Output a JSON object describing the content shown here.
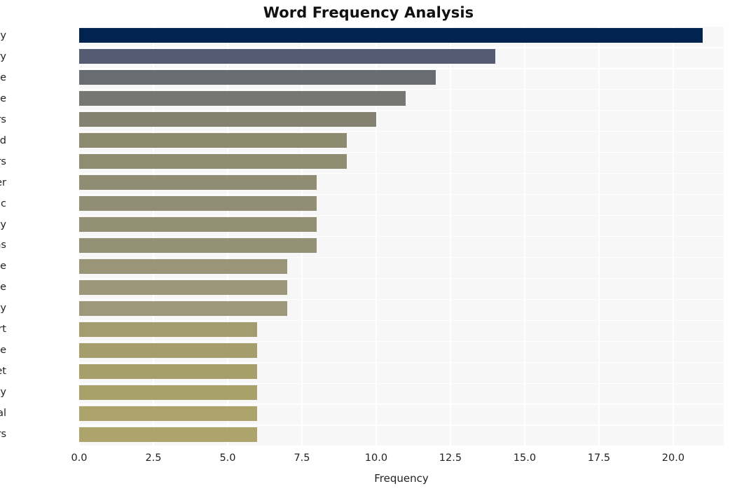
{
  "chart_data": {
    "type": "bar",
    "orientation": "horizontal",
    "title": "Word Frequency Analysis",
    "xlabel": "Frequency",
    "ylabel": "",
    "categories": [
      "cybersecurity",
      "industry",
      "active",
      "time",
      "buyers",
      "trend",
      "investors",
      "cyber",
      "strategic",
      "activity",
      "acquisitions",
      "change",
      "private",
      "equity",
      "report",
      "altitude",
      "let",
      "pretty",
      "deal",
      "years"
    ],
    "values": [
      21,
      14,
      12,
      11,
      10,
      9,
      9,
      8,
      8,
      8,
      8,
      7,
      7,
      7,
      6,
      6,
      6,
      6,
      6,
      6
    ],
    "bar_colors": [
      "#002350",
      "#565b74",
      "#6a6c74",
      "#767672",
      "#83816f",
      "#8d8a70",
      "#908c72",
      "#918d74",
      "#928e75",
      "#939076",
      "#959177",
      "#9a9479",
      "#9c967a",
      "#9e987b",
      "#a39c6e",
      "#a59e6c",
      "#a79f6b",
      "#a9a16a",
      "#aba36a",
      "#aca46a"
    ],
    "xlim": [
      0,
      21.7
    ],
    "xticks": [
      0,
      2.5,
      5,
      7.5,
      10,
      12.5,
      15,
      17.5,
      20
    ],
    "xtick_labels": [
      "0.0",
      "2.5",
      "5.0",
      "7.5",
      "10.0",
      "12.5",
      "15.0",
      "17.5",
      "20.0"
    ],
    "grid": true,
    "grid_color": "#ffffff",
    "plot_background": "#f7f7f7",
    "figure_background": "#ffffff",
    "legend": null
  }
}
